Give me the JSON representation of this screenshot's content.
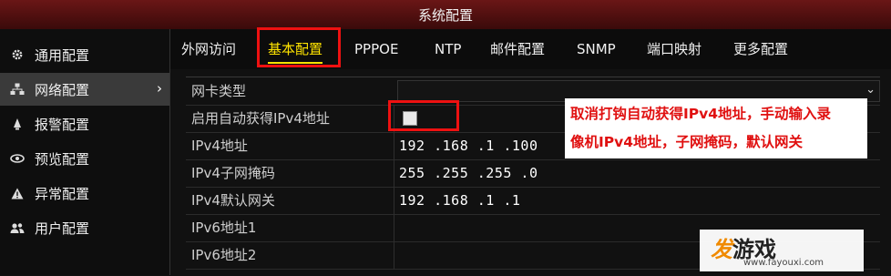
{
  "window": {
    "title": "系统配置"
  },
  "sidebar": {
    "items": [
      {
        "label": "通用配置",
        "icon": "gear-icon"
      },
      {
        "label": "网络配置",
        "icon": "network-icon",
        "active": true
      },
      {
        "label": "报警配置",
        "icon": "alarm-icon"
      },
      {
        "label": "预览配置",
        "icon": "eye-icon"
      },
      {
        "label": "异常配置",
        "icon": "warning-icon"
      },
      {
        "label": "用户配置",
        "icon": "users-icon"
      }
    ],
    "chevron": "›"
  },
  "tabs": [
    {
      "label": "外网访问"
    },
    {
      "label": "基本配置",
      "active": true
    },
    {
      "label": "PPPOE"
    },
    {
      "label": "NTP"
    },
    {
      "label": "邮件配置"
    },
    {
      "label": "SNMP"
    },
    {
      "label": "端口映射"
    },
    {
      "label": "更多配置"
    }
  ],
  "form": {
    "rows": [
      {
        "label": "网卡类型",
        "type": "dropdown",
        "value": ""
      },
      {
        "label": "启用自动获得IPv4地址",
        "type": "checkbox",
        "checked": false
      },
      {
        "label": "IPv4地址",
        "value": "192 .168 .1    .100"
      },
      {
        "label": "IPv4子网掩码",
        "value": "255 .255 .255 .0"
      },
      {
        "label": "IPv4默认网关",
        "value": "192 .168 .1    .1"
      },
      {
        "label": "IPv6地址1",
        "value": ""
      },
      {
        "label": "IPv6地址2",
        "value": ""
      }
    ]
  },
  "annotation": {
    "line1": "取消打钩自动获得IPv4地址，手动输入录",
    "line2": "像机IPv4地址，子网掩码，默认网关"
  },
  "watermark": {
    "brand_first": "发",
    "brand_rest": "游戏",
    "url": "www.fayouxi.com"
  },
  "colors": {
    "accent": "#ffe400",
    "highlight": "#e11111",
    "titlebar": "#5a1212"
  }
}
